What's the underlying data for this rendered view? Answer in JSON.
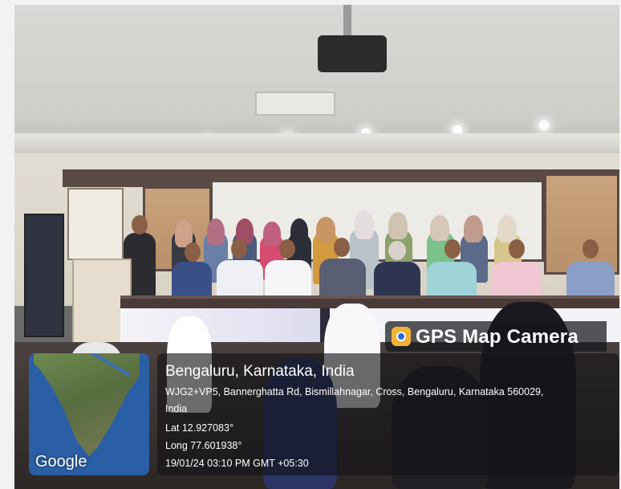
{
  "overlay": {
    "app_name": "GPS Map Camera",
    "place_title": "Bengaluru, Karnataka, India",
    "address_line1": "WJG2+VP5, Bannerghatta Rd, Bismillahnagar, Cross, Bengaluru, Karnataka 560029,",
    "address_line2": "India",
    "latitude": "Lat 12.927083°",
    "longitude": "Long 77.601938°",
    "datetime": "19/01/24 03:10 PM GMT +05:30",
    "map_brand": "Google"
  },
  "icons": {
    "gps_app_icon": "gps-map-camera-icon"
  },
  "colors": {
    "overlay_bg": "#141618",
    "gps_icon_bg": "#f2b233",
    "map_water": "#2a5ea5"
  }
}
